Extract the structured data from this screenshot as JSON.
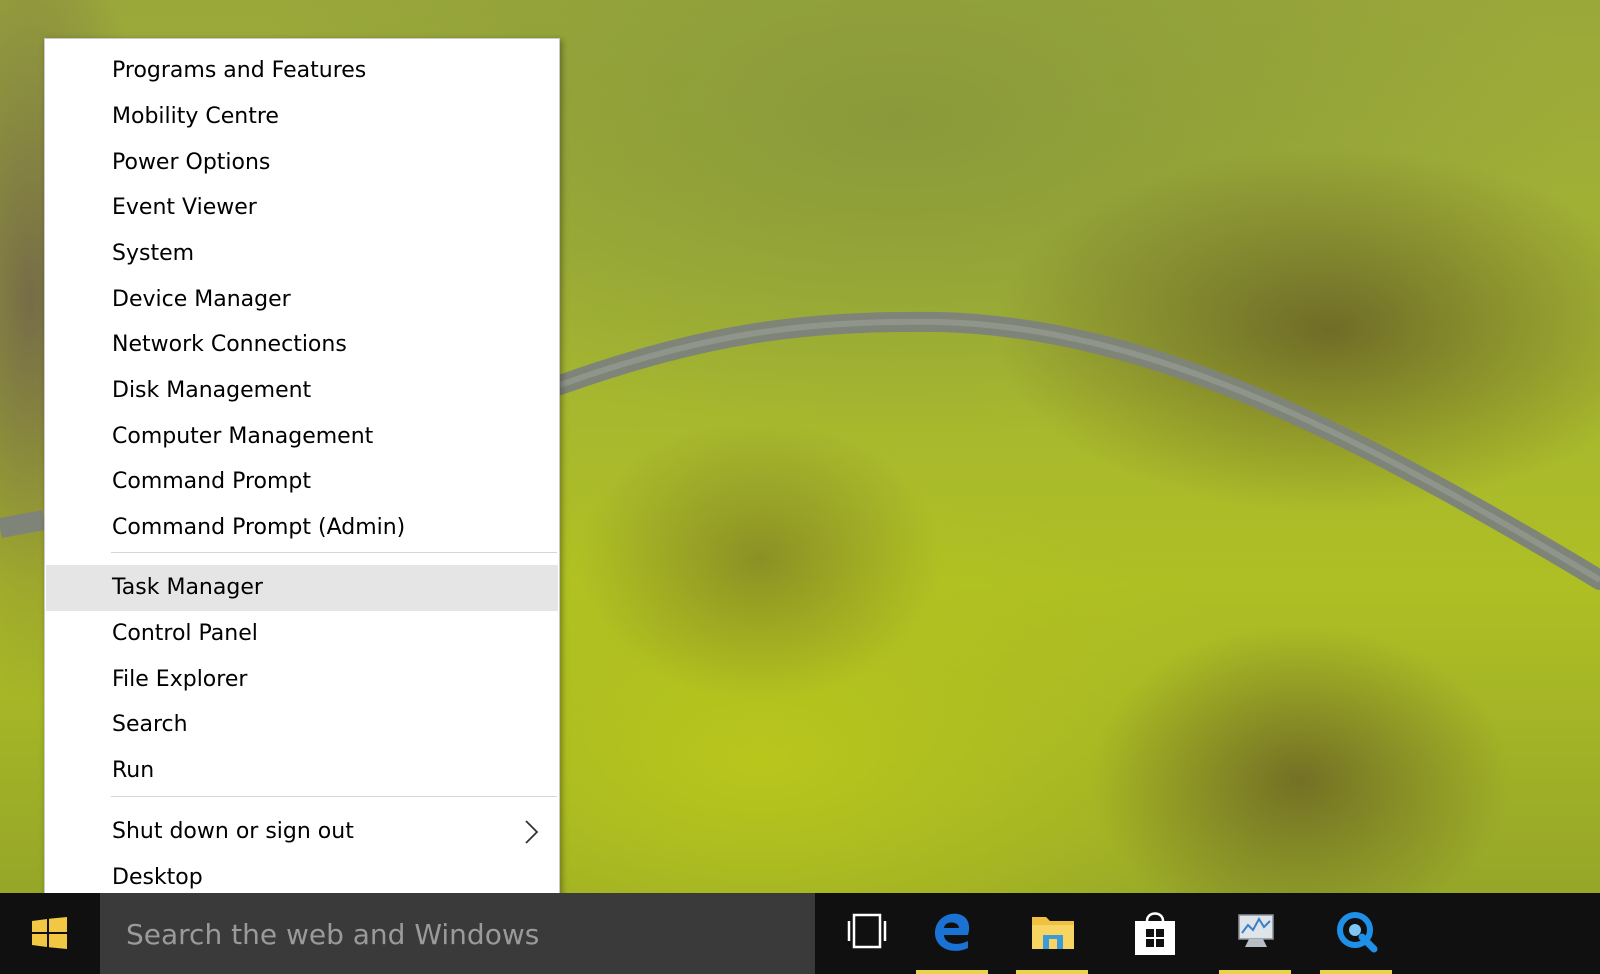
{
  "context_menu": {
    "items": [
      {
        "label": "Programs and Features"
      },
      {
        "label": "Mobility Centre"
      },
      {
        "label": "Power Options"
      },
      {
        "label": "Event Viewer"
      },
      {
        "label": "System"
      },
      {
        "label": "Device Manager"
      },
      {
        "label": "Network Connections"
      },
      {
        "label": "Disk Management"
      },
      {
        "label": "Computer Management"
      },
      {
        "label": "Command Prompt"
      },
      {
        "label": "Command Prompt (Admin)"
      },
      {
        "label": "Task Manager",
        "highlighted": true
      },
      {
        "label": "Control Panel"
      },
      {
        "label": "File Explorer"
      },
      {
        "label": "Search"
      },
      {
        "label": "Run"
      },
      {
        "label": "Shut down or sign out",
        "has_submenu": true
      },
      {
        "label": "Desktop"
      }
    ]
  },
  "taskbar": {
    "search": {
      "placeholder": "Search the web and Windows"
    },
    "icons": [
      {
        "name": "task-view-icon",
        "running": false
      },
      {
        "name": "edge-icon",
        "running": true
      },
      {
        "name": "file-explorer-icon",
        "running": true
      },
      {
        "name": "store-icon",
        "running": false
      },
      {
        "name": "performance-monitor-icon",
        "running": true
      },
      {
        "name": "quicktime-icon",
        "running": true
      }
    ]
  },
  "colors": {
    "menu_background": "#ffffff",
    "menu_highlight": "#e5e5e5",
    "taskbar": "#101010",
    "search_box": "#3a3a3a",
    "running_indicator": "#e8d24a",
    "windows_logo": "#f2c744",
    "edge_blue": "#1a73d4"
  }
}
